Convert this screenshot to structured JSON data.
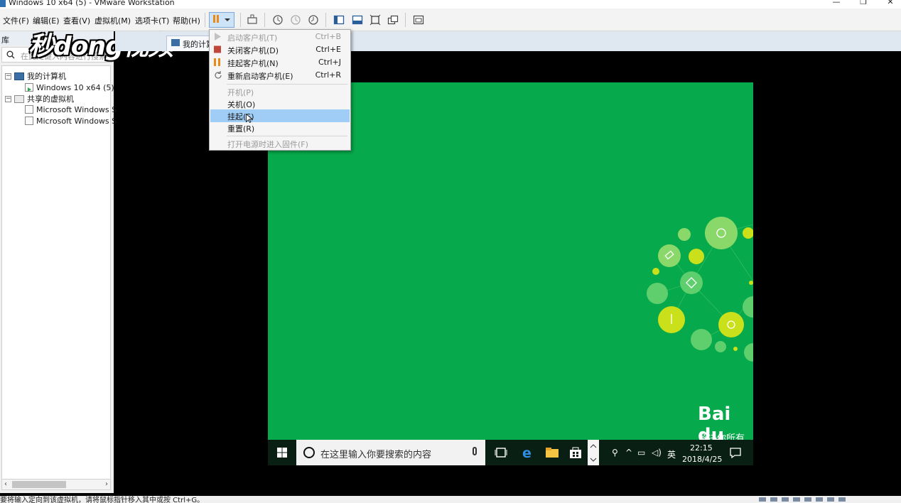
{
  "window": {
    "title": "Windows 10 x64 (5) - VMware Workstation",
    "min": "—",
    "restore": "❐",
    "close": "✕"
  },
  "menubar": {
    "items": [
      "文件(F)",
      "编辑(E)",
      "查看(V)",
      "虚拟机(M)",
      "选项卡(T)",
      "帮助(H)"
    ]
  },
  "library": {
    "header": "库",
    "search_placeholder": "在此处键入内容进行搜索",
    "tree": [
      {
        "label": "我的计算机"
      },
      {
        "label": "Windows 10 x64 (5)"
      },
      {
        "label": "共享的虚拟机"
      },
      {
        "label": "Microsoft Windows S"
      },
      {
        "label": "Microsoft Windows S"
      }
    ]
  },
  "watermark": {
    "text": "秒dong视频"
  },
  "tabs": {
    "vm_tab": "我的计算"
  },
  "power_menu": {
    "items": [
      {
        "label": "启动客户机(T)",
        "shortcut": "Ctrl+B",
        "icon": "play-icon"
      },
      {
        "label": "关闭客户机(D)",
        "shortcut": "Ctrl+E",
        "icon": "stop-icon"
      },
      {
        "label": "挂起客户机(N)",
        "shortcut": "Ctrl+J",
        "icon": "pause-icon"
      },
      {
        "label": "重新启动客户机(E)",
        "shortcut": "Ctrl+R",
        "icon": "restart-icon"
      },
      {
        "label": "开机(P)",
        "shortcut": ""
      },
      {
        "label": "关机(O)",
        "shortcut": ""
      },
      {
        "label": "挂起(S)",
        "shortcut": ""
      },
      {
        "label": "重置(R)",
        "shortcut": ""
      },
      {
        "label": "打开电源时进入固件(F)",
        "shortcut": ""
      }
    ]
  },
  "guest": {
    "baidu_logo": "Bai du",
    "baidu_slogan": "解决你所有",
    "taskbar": {
      "search_placeholder": "在这里输入你要搜索的内容",
      "time": "22:15",
      "date": "2018/4/25",
      "ime": "英"
    }
  },
  "statusbar": {
    "text": "要将输入定向到该虚拟机，请将鼠标指针移入其中或按 Ctrl+G。"
  },
  "colors": {
    "accent": "#e88b1b",
    "desktop_green": "#06a94b",
    "highlight": "#9fcdf5"
  }
}
